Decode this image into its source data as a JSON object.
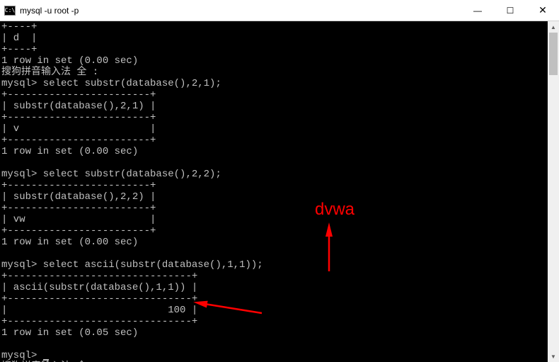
{
  "titlebar": {
    "icon_text": "C:\\",
    "title": "mysql  -u root -p",
    "minimize": "—",
    "maximize": "☐",
    "close": "✕"
  },
  "terminal": {
    "lines": [
      "+----+",
      "| d  |",
      "+----+",
      "1 row in set (0.00 sec)",
      "搜狗拼音输入法 全 :",
      "mysql> select substr(database(),2,1);",
      "+------------------------+",
      "| substr(database(),2,1) |",
      "+------------------------+",
      "| v                      |",
      "+------------------------+",
      "1 row in set (0.00 sec)",
      "",
      "mysql> select substr(database(),2,2);",
      "+------------------------+",
      "| substr(database(),2,2) |",
      "+------------------------+",
      "| vw                     |",
      "+------------------------+",
      "1 row in set (0.00 sec)",
      "",
      "mysql> select ascii(substr(database(),1,1));",
      "+-------------------------------+",
      "| ascii(substr(database(),1,1)) |",
      "+-------------------------------+",
      "|                           100 |",
      "+-------------------------------+",
      "1 row in set (0.05 sec)",
      "",
      "mysql> ",
      "搜狗拼音输入法 全 :"
    ],
    "prompt_cursor_line_index": 29
  },
  "annotations": {
    "label": "dvwa",
    "arrow_color": "#ff0000"
  }
}
